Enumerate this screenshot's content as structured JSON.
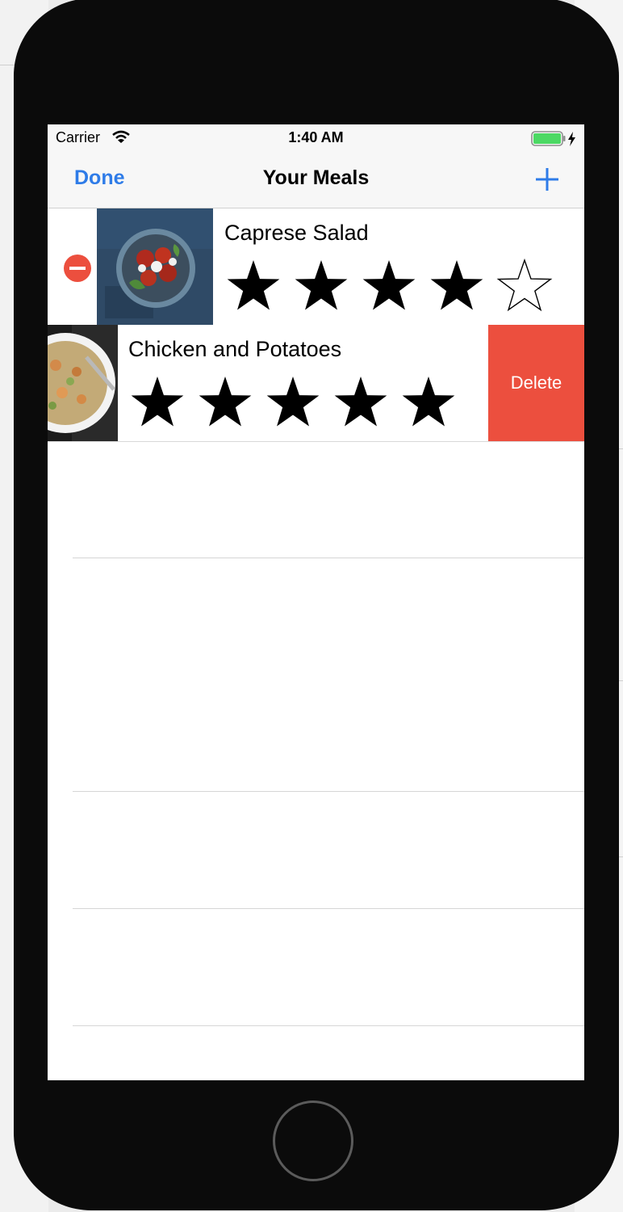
{
  "status_bar": {
    "carrier": "Carrier",
    "time": "1:40 AM"
  },
  "nav": {
    "done_label": "Done",
    "title": "Your Meals",
    "add_icon": "plus-icon"
  },
  "meals": [
    {
      "name": "Caprese Salad",
      "rating": 4,
      "max_rating": 5
    },
    {
      "name": "Chicken and Potatoes",
      "rating": 5,
      "max_rating": 5
    }
  ],
  "row_actions": {
    "delete_label": "Delete"
  },
  "colors": {
    "accent": "#2f7ce8",
    "delete_red": "#ec4f3e",
    "battery_green": "#4cd964",
    "nav_background": "#f7f7f7"
  }
}
